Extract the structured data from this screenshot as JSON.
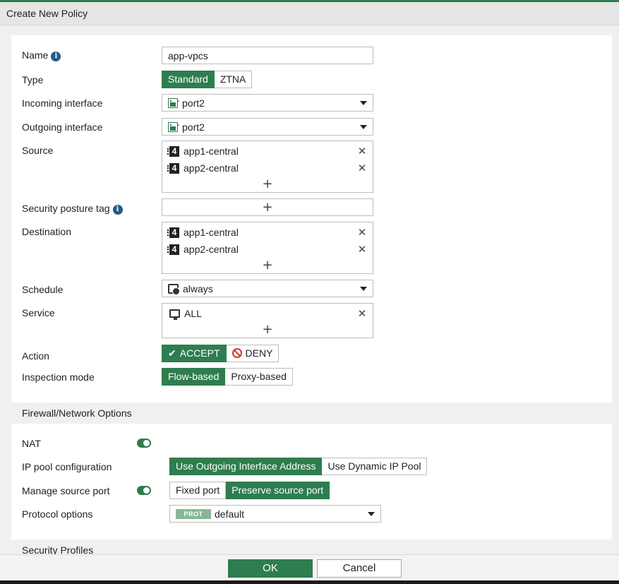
{
  "header": {
    "title": "Create New Policy"
  },
  "form": {
    "name": {
      "label": "Name",
      "value": "app-vpcs"
    },
    "type": {
      "label": "Type",
      "options": [
        "Standard",
        "ZTNA"
      ],
      "selected": "Standard"
    },
    "incoming": {
      "label": "Incoming interface",
      "value": "port2"
    },
    "outgoing": {
      "label": "Outgoing interface",
      "value": "port2"
    },
    "source": {
      "label": "Source",
      "entries": [
        "app1-central",
        "app2-central"
      ]
    },
    "posture": {
      "label": "Security posture tag"
    },
    "destination": {
      "label": "Destination",
      "entries": [
        "app1-central",
        "app2-central"
      ]
    },
    "schedule": {
      "label": "Schedule",
      "value": "always"
    },
    "service": {
      "label": "Service",
      "entries": [
        "ALL"
      ]
    },
    "action": {
      "label": "Action",
      "accept": "ACCEPT",
      "deny": "DENY",
      "selected": "ACCEPT"
    },
    "inspection": {
      "label": "Inspection mode",
      "options": [
        "Flow-based",
        "Proxy-based"
      ],
      "selected": "Flow-based"
    }
  },
  "firewall": {
    "title": "Firewall/Network Options",
    "nat": {
      "label": "NAT",
      "enabled": true
    },
    "ippool": {
      "label": "IP pool configuration",
      "options": [
        "Use Outgoing Interface Address",
        "Use Dynamic IP Pool"
      ],
      "selected": "Use Outgoing Interface Address"
    },
    "srcport": {
      "label": "Manage source port",
      "enabled": true,
      "options": [
        "Fixed port",
        "Preserve source port"
      ],
      "selected": "Preserve source port"
    },
    "protocol": {
      "label": "Protocol options",
      "badge": "PROT",
      "value": "default"
    }
  },
  "security": {
    "title": "Security Profiles"
  },
  "footer": {
    "ok": "OK",
    "cancel": "Cancel"
  },
  "colors": {
    "accent": "#2e7d4f",
    "info": "#1f5c8c",
    "deny": "#d9342b"
  }
}
